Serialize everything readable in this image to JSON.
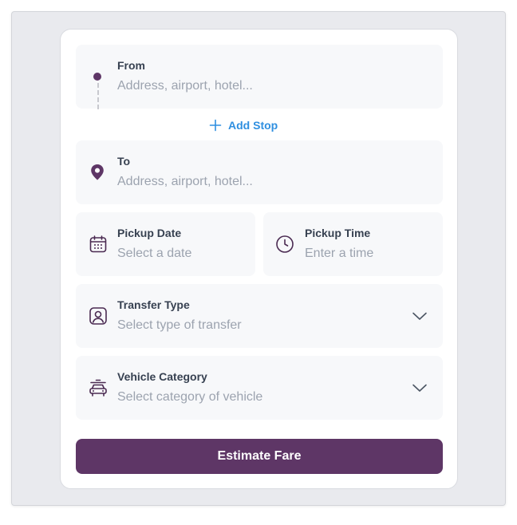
{
  "form": {
    "from": {
      "label": "From",
      "placeholder": "Address, airport, hotel..."
    },
    "add_stop": {
      "label": "Add Stop",
      "icon": "plus-icon"
    },
    "to": {
      "label": "To",
      "placeholder": "Address, airport, hotel..."
    },
    "pickup_date": {
      "label": "Pickup Date",
      "placeholder": "Select a date",
      "icon": "calendar-icon"
    },
    "pickup_time": {
      "label": "Pickup Time",
      "placeholder": "Enter a time",
      "icon": "clock-icon"
    },
    "transfer_type": {
      "label": "Transfer Type",
      "placeholder": "Select type of transfer",
      "icon": "person-badge-icon"
    },
    "vehicle_category": {
      "label": "Vehicle Category",
      "placeholder": "Select category of vehicle",
      "icon": "car-icon"
    },
    "submit_label": "Estimate Fare"
  },
  "colors": {
    "primary": "#5e3666",
    "link": "#2f8fe0",
    "field_bg": "#f7f8fa",
    "placeholder": "#9ca3af",
    "label": "#374151"
  }
}
